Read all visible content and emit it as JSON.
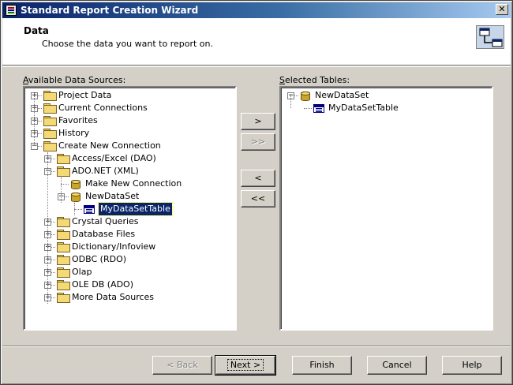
{
  "window": {
    "title": "Standard Report Creation Wizard",
    "close_glyph": "✕"
  },
  "header": {
    "title": "Data",
    "subtitle": "Choose the data you want to report on."
  },
  "available": {
    "label_prefix": "A",
    "label_rest": "vailable Data Sources:",
    "items": [
      {
        "label": "Project Data",
        "expander": "+",
        "icon": "folder-icon"
      },
      {
        "label": "Current Connections",
        "expander": "+",
        "icon": "folder-icon"
      },
      {
        "label": "Favorites",
        "expander": "+",
        "icon": "folder-icon"
      },
      {
        "label": "History",
        "expander": "+",
        "icon": "folder-icon"
      },
      {
        "label": "Create New Connection",
        "expander": "−",
        "icon": "folder-icon"
      },
      {
        "label": "Access/Excel (DAO)",
        "expander": "+",
        "icon": "folder-icon"
      },
      {
        "label": "ADO.NET (XML)",
        "expander": "−",
        "icon": "folder-icon"
      },
      {
        "label": "Make New Connection",
        "expander": "",
        "icon": "database-icon"
      },
      {
        "label": "NewDataSet",
        "expander": "−",
        "icon": "database-icon"
      },
      {
        "label": "MyDataSetTable",
        "expander": "",
        "icon": "table-icon"
      },
      {
        "label": "Crystal Queries",
        "expander": "+",
        "icon": "folder-icon"
      },
      {
        "label": "Database Files",
        "expander": "+",
        "icon": "folder-icon"
      },
      {
        "label": "Dictionary/Infoview",
        "expander": "+",
        "icon": "folder-icon"
      },
      {
        "label": "ODBC (RDO)",
        "expander": "+",
        "icon": "folder-icon"
      },
      {
        "label": "Olap",
        "expander": "+",
        "icon": "folder-icon"
      },
      {
        "label": "OLE DB (ADO)",
        "expander": "+",
        "icon": "folder-icon"
      },
      {
        "label": "More Data Sources",
        "expander": "+",
        "icon": "folder-icon"
      }
    ]
  },
  "selected": {
    "label_prefix": "S",
    "label_rest": "elected Tables:",
    "items": [
      {
        "label": "NewDataSet",
        "expander": "−",
        "icon": "database-icon"
      },
      {
        "label": "MyDataSetTable",
        "expander": "",
        "icon": "table-icon"
      }
    ]
  },
  "move_buttons": {
    "add_one": ">",
    "add_all": ">>",
    "remove_one": "<",
    "remove_all": "<<"
  },
  "footer": {
    "back": "< Back",
    "next": "Next >",
    "finish": "Finish",
    "cancel": "Cancel",
    "help": "Help"
  }
}
